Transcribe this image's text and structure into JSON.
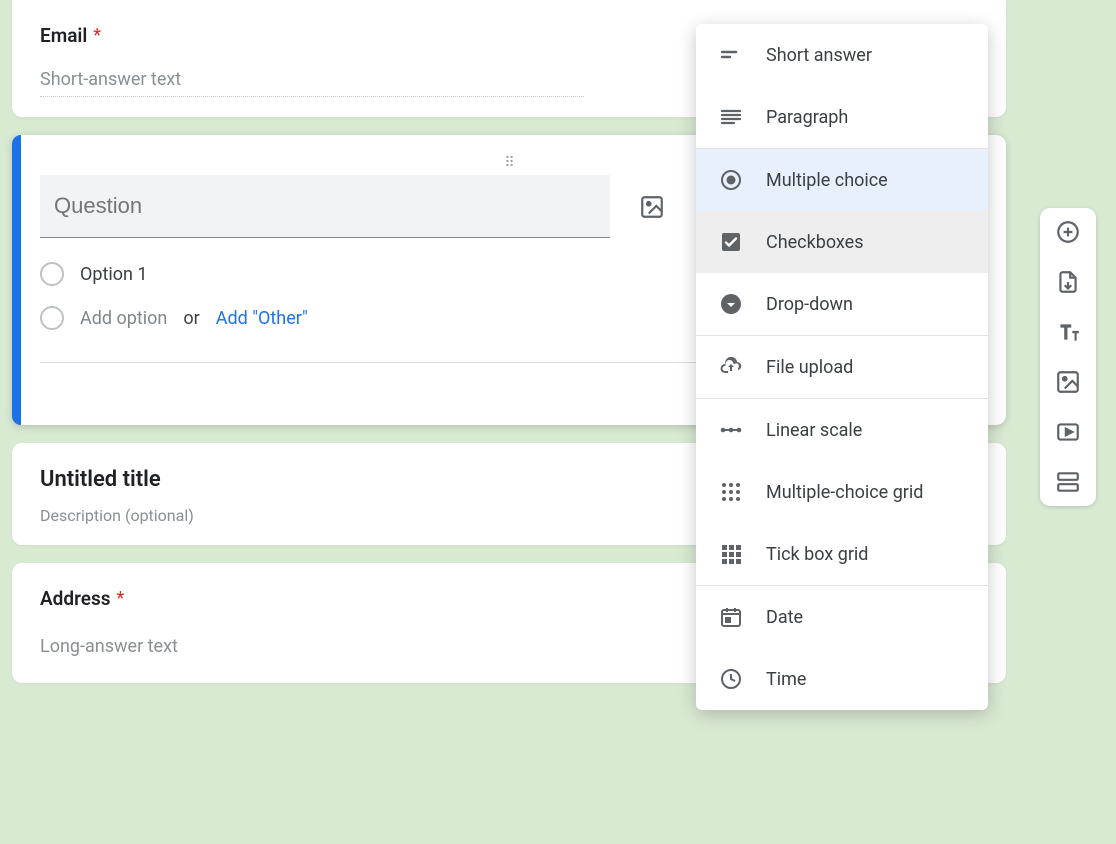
{
  "email_card": {
    "label": "Email",
    "required_mark": "*",
    "placeholder": "Short-answer text"
  },
  "active_question": {
    "question_placeholder": "Question",
    "option1": "Option 1",
    "add_option": "Add option",
    "or_word": "or",
    "add_other": "Add \"Other\""
  },
  "title_card": {
    "title": "Untitled title",
    "description_placeholder": "Description (optional)"
  },
  "address_card": {
    "label": "Address",
    "required_mark": "*",
    "placeholder": "Long-answer text"
  },
  "type_menu": {
    "short_answer": "Short answer",
    "paragraph": "Paragraph",
    "multiple_choice": "Multiple choice",
    "checkboxes": "Checkboxes",
    "drop_down": "Drop-down",
    "file_upload": "File upload",
    "linear_scale": "Linear scale",
    "mc_grid": "Multiple-choice grid",
    "tick_grid": "Tick box grid",
    "date": "Date",
    "time": "Time"
  }
}
